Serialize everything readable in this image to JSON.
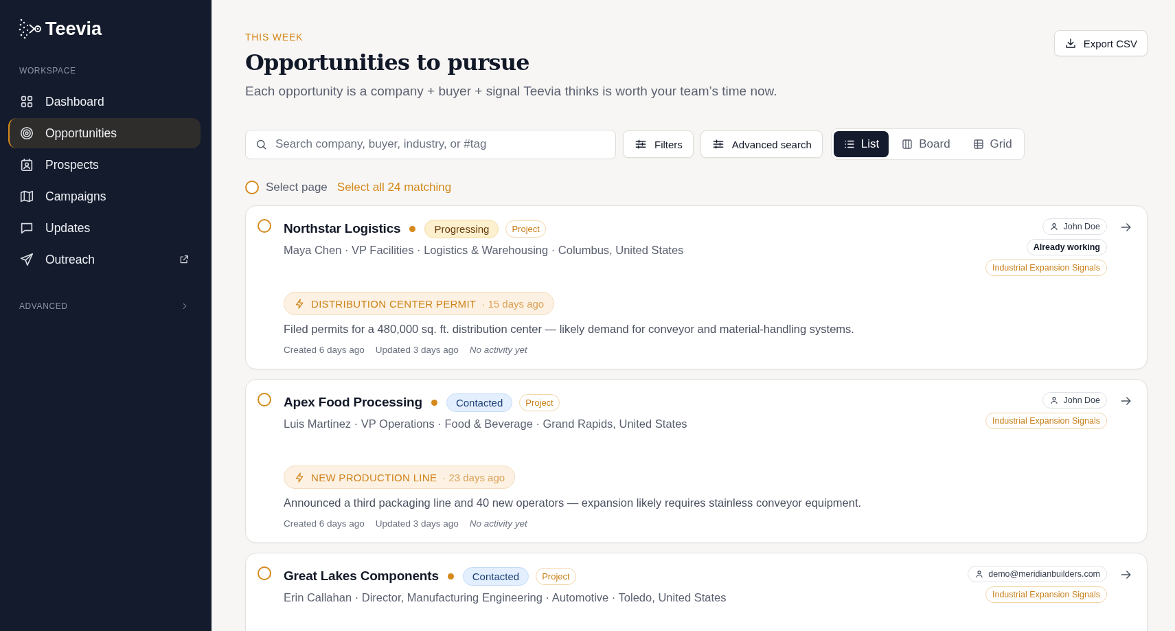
{
  "sidebar": {
    "brand": "Teevia",
    "section_label": "WORKSPACE",
    "items": [
      {
        "label": "Dashboard",
        "selected": false
      },
      {
        "label": "Opportunities",
        "selected": true
      },
      {
        "label": "Prospects",
        "selected": false
      },
      {
        "label": "Campaigns",
        "selected": false
      },
      {
        "label": "Updates",
        "selected": false
      },
      {
        "label": "Outreach",
        "selected": false,
        "external": true
      }
    ],
    "advanced": {
      "label": "ADVANCED",
      "expanded": false
    }
  },
  "header": {
    "eyebrow": "THIS WEEK",
    "title": "Opportunities to pursue",
    "description": "Each opportunity is a company + buyer + signal Teevia thinks is worth your team’s time now.",
    "export_button": "Export CSV"
  },
  "toolbar": {
    "search": {
      "placeholder": "Search company, buyer, industry, or #tag"
    },
    "filters_button": "Filters",
    "advanced_search_button": "Advanced search",
    "views": [
      {
        "label": "List",
        "selected": true
      },
      {
        "label": "Board",
        "selected": false
      },
      {
        "label": "Grid",
        "selected": false
      }
    ]
  },
  "selection": {
    "selected": false,
    "label": "Select page",
    "select_all_link": "Select all 24 matching"
  },
  "cards": [
    {
      "selected": false,
      "company": "Northstar Logistics",
      "status": {
        "label": "Progressing",
        "kind": "progressing"
      },
      "type_tag": "Project",
      "meta": "Maya Chen · VP Facilities · Logistics & Warehousing · Columbus, United States",
      "assignee": "John Doe",
      "note": "Already working",
      "tags": [
        "Industrial Expansion Signals"
      ],
      "signal": {
        "title": "DISTRIBUTION CENTER PERMIT",
        "age": "· 15 days ago"
      },
      "description": "Filed permits for a 480,000 sq. ft. distribution center — likely demand for conveyor and material-handling systems.",
      "created": "Created 6 days ago",
      "updated": "Updated 3 days ago",
      "activity": "No activity yet"
    },
    {
      "selected": false,
      "company": "Apex Food Processing",
      "status": {
        "label": "Contacted",
        "kind": "contacted"
      },
      "type_tag": "Project",
      "meta": "Luis Martinez · VP Operations · Food & Beverage · Grand Rapids, United States",
      "assignee": "John Doe",
      "tags": [
        "Industrial Expansion Signals"
      ],
      "signal": {
        "title": "NEW PRODUCTION LINE",
        "age": "· 23 days ago"
      },
      "description": "Announced a third packaging line and 40 new operators — expansion likely requires stainless conveyor equipment.",
      "created": "Created 6 days ago",
      "updated": "Updated 3 days ago",
      "activity": "No activity yet"
    },
    {
      "selected": false,
      "company": "Great Lakes Components",
      "status": {
        "label": "Contacted",
        "kind": "contacted"
      },
      "type_tag": "Project",
      "meta": "Erin Callahan · Director, Manufacturing Engineering · Automotive · Toledo, United States",
      "assignee": "demo@meridianbuilders.com",
      "tags": [
        "Industrial Expansion Signals"
      ]
    }
  ]
}
